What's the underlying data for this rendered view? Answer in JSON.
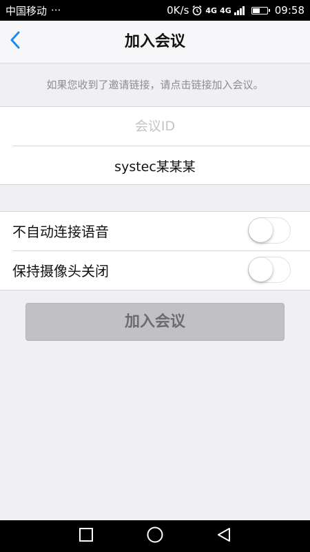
{
  "status_bar": {
    "carrier": "中国移动",
    "more_dots": "···",
    "net_speed": "0K/s",
    "network_1": "4G",
    "network_2": "4G",
    "time": "09:58",
    "battery_level": 0.55
  },
  "nav": {
    "title": "加入会议",
    "back_icon": "chevron-left-icon"
  },
  "hint": "如果您收到了邀请链接，请点击链接加入会议。",
  "meeting_form": {
    "meeting_id_placeholder": "会议ID",
    "meeting_id_value": "",
    "display_name_value": "systec某某某"
  },
  "settings": [
    {
      "label": "不自动连接语音",
      "enabled": false
    },
    {
      "label": "保持摄像头关闭",
      "enabled": false
    }
  ],
  "join_button_label": "加入会议",
  "colors": {
    "accent": "#1a8cf0",
    "background": "#efeff4",
    "disabled_button": "#c1c1c5"
  },
  "android_nav": {
    "recent_icon": "square-icon",
    "home_icon": "circle-icon",
    "back_icon": "triangle-back-icon"
  }
}
